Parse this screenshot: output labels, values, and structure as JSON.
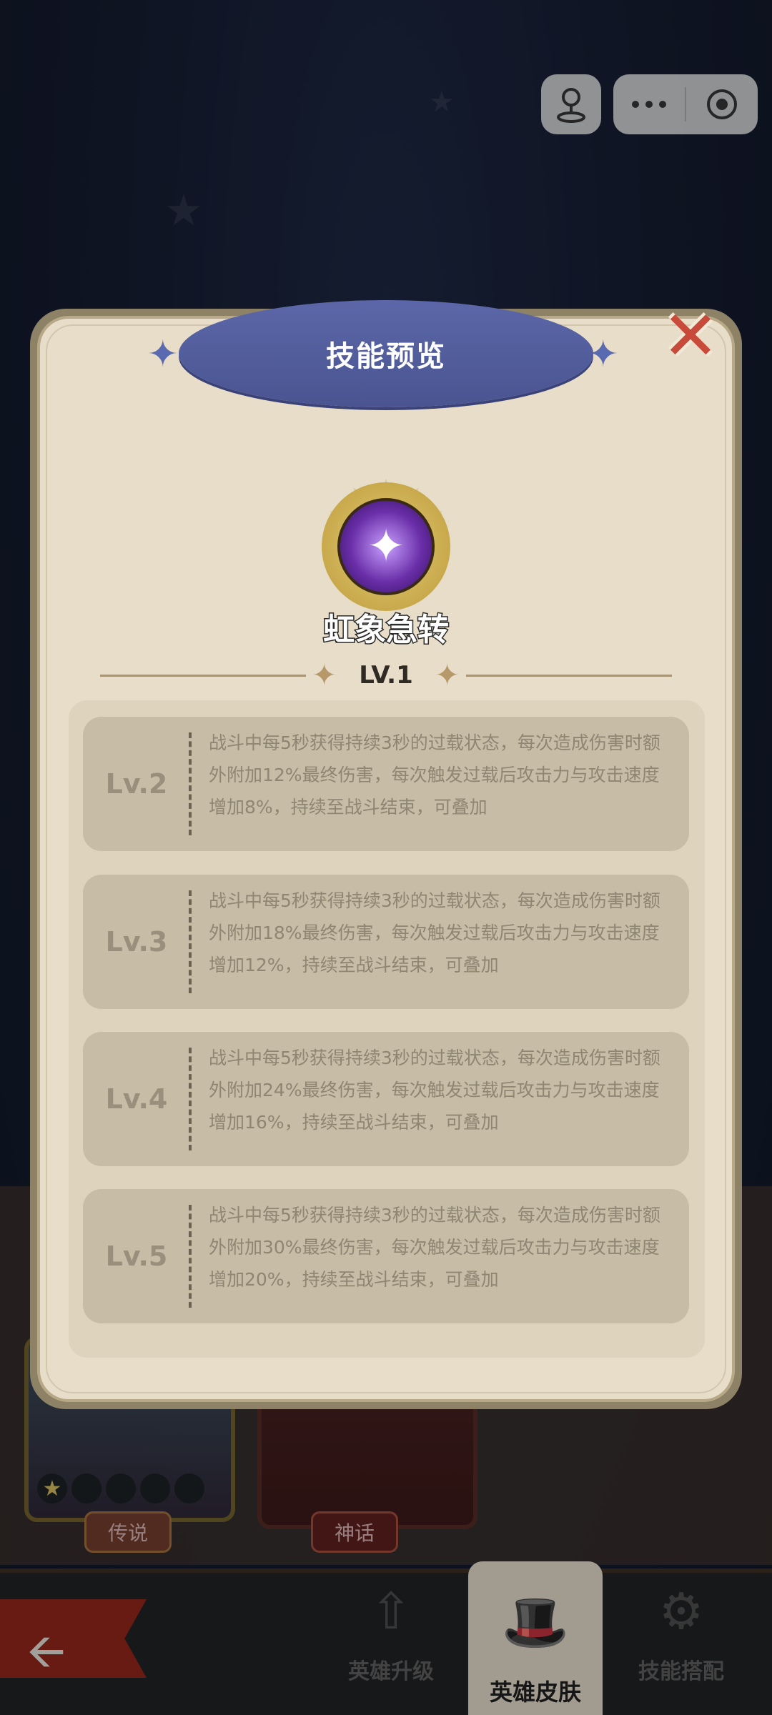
{
  "capsule": {
    "profile_icon": "person-pin-icon",
    "more_icon": "more-dots-icon",
    "close_icon": "target-circle-icon"
  },
  "modal": {
    "title": "技能预览",
    "skill_name": "虹象急转",
    "current_level": "LV.1",
    "levels": [
      {
        "label": "Lv.2",
        "desc": "战斗中每5秒获得持续3秒的过载状态，每次造成伤害时额外附加12%最终伤害，每次触发过载后攻击力与攻击速度增加8%，持续至战斗结束，可叠加"
      },
      {
        "label": "Lv.3",
        "desc": "战斗中每5秒获得持续3秒的过载状态，每次造成伤害时额外附加18%最终伤害，每次触发过载后攻击力与攻击速度增加12%，持续至战斗结束，可叠加"
      },
      {
        "label": "Lv.4",
        "desc": "战斗中每5秒获得持续3秒的过载状态，每次造成伤害时额外附加24%最终伤害，每次触发过载后攻击力与攻击速度增加16%，持续至战斗结束，可叠加"
      },
      {
        "label": "Lv.5",
        "desc": "战斗中每5秒获得持续3秒的过载状态，每次造成伤害时额外附加30%最终伤害，每次触发过载后攻击力与攻击速度增加20%，持续至战斗结束，可叠加"
      }
    ]
  },
  "background": {
    "rarity_legend": "传说",
    "rarity_myth": "神话"
  },
  "bottom_nav": {
    "items": [
      {
        "label": "英雄升级",
        "icon": "upgrade-arrow-icon"
      },
      {
        "label": "英雄皮肤",
        "icon": "wizard-hat-icon"
      },
      {
        "label": "技能搭配",
        "icon": "gear-icon"
      }
    ]
  },
  "colors": {
    "accent_banner": "#4a5491",
    "close": "#c84a3a",
    "panel": "#e7ddc9"
  }
}
